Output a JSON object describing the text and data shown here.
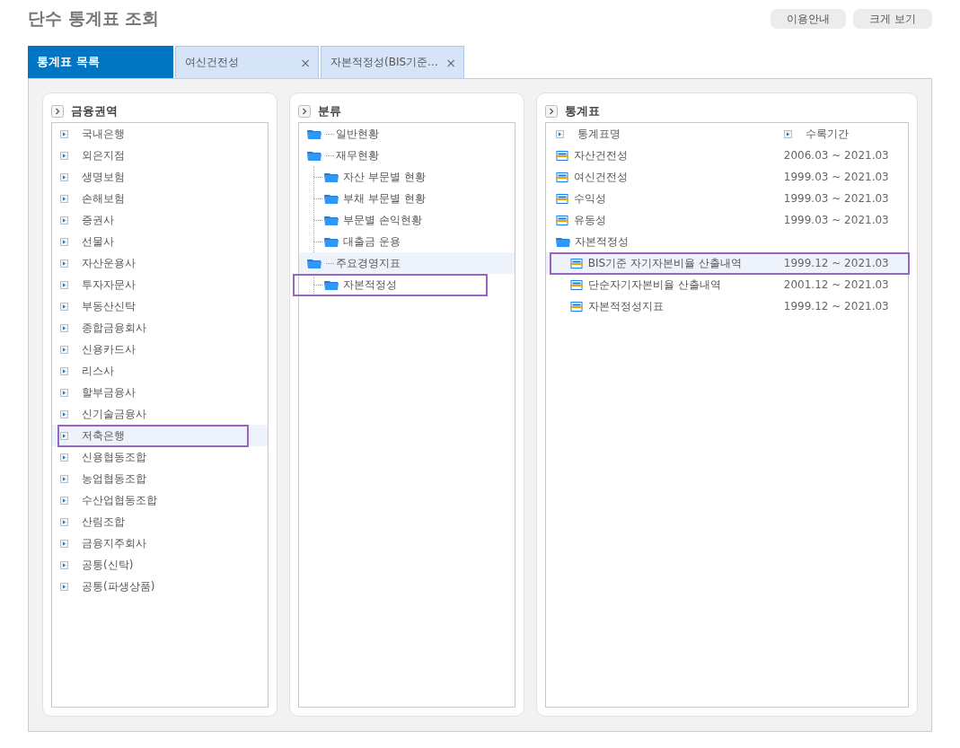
{
  "title": "단수 통계표 조회",
  "header_buttons": [
    "이용안내",
    "크게 보기"
  ],
  "tabs": [
    {
      "label": "통계표 목록",
      "selected": true
    },
    {
      "label": "여신건전성",
      "selected": false,
      "close": "×"
    },
    {
      "label": "자본적정성(BIS기준...",
      "selected": false,
      "close": "×"
    }
  ],
  "sectors": {
    "title": "금융권역",
    "items": [
      {
        "label": "국내은행",
        "selected": false,
        "highlighted": false
      },
      {
        "label": "외은지점",
        "selected": false,
        "highlighted": false
      },
      {
        "label": "생명보험",
        "selected": false,
        "highlighted": false
      },
      {
        "label": "손해보험",
        "selected": false,
        "highlighted": false
      },
      {
        "label": "증권사",
        "selected": false,
        "highlighted": false
      },
      {
        "label": "선물사",
        "selected": false,
        "highlighted": false
      },
      {
        "label": "자산운용사",
        "selected": false,
        "highlighted": false
      },
      {
        "label": "투자자문사",
        "selected": false,
        "highlighted": false
      },
      {
        "label": "부동산신탁",
        "selected": false,
        "highlighted": false
      },
      {
        "label": "종합금융회사",
        "selected": false,
        "highlighted": false
      },
      {
        "label": "신용카드사",
        "selected": false,
        "highlighted": false
      },
      {
        "label": "리스사",
        "selected": false,
        "highlighted": false
      },
      {
        "label": "할부금융사",
        "selected": false,
        "highlighted": false
      },
      {
        "label": "신기술금융사",
        "selected": false,
        "highlighted": false
      },
      {
        "label": "저축은행",
        "selected": true,
        "highlighted": true
      },
      {
        "label": "신용협동조합",
        "selected": false,
        "highlighted": false
      },
      {
        "label": "농업협동조합",
        "selected": false,
        "highlighted": false
      },
      {
        "label": "수산업협동조합",
        "selected": false,
        "highlighted": false
      },
      {
        "label": "산림조합",
        "selected": false,
        "highlighted": false
      },
      {
        "label": "금융지주회사",
        "selected": false,
        "highlighted": false
      },
      {
        "label": "공통(신탁)",
        "selected": false,
        "highlighted": false
      },
      {
        "label": "공통(파생상품)",
        "selected": false,
        "highlighted": false
      }
    ]
  },
  "categories": {
    "title": "분류",
    "items": [
      {
        "label": "일반현황",
        "selected": false,
        "highlighted": false
      },
      {
        "label": "재무현황",
        "selected": false,
        "highlighted": false,
        "children": [
          {
            "label": "자산 부문별 현황",
            "selected": false,
            "highlighted": false
          },
          {
            "label": "부채 부문별 현황",
            "selected": false,
            "highlighted": false
          },
          {
            "label": "부문별 손익현황",
            "selected": false,
            "highlighted": false
          },
          {
            "label": "대출금 운용",
            "selected": false,
            "highlighted": false
          }
        ]
      },
      {
        "label": "주요경영지표",
        "selected": false,
        "highlighted": true,
        "children": [
          {
            "label": "자본적정성",
            "selected": true,
            "highlighted": false
          }
        ]
      }
    ]
  },
  "tables": {
    "title": "통계표",
    "columns": [
      "통계표명",
      "수록기간"
    ],
    "rows": [
      {
        "kind": "table",
        "name": "자산건전성",
        "period": "2006.03 ~ 2021.03",
        "selected": false
      },
      {
        "kind": "table",
        "name": "여신건전성",
        "period": "1999.03 ~ 2021.03",
        "selected": false
      },
      {
        "kind": "table",
        "name": "수익성",
        "period": "1999.03 ~ 2021.03",
        "selected": false
      },
      {
        "kind": "table",
        "name": "유동성",
        "period": "1999.03 ~ 2021.03",
        "selected": false
      },
      {
        "kind": "folder",
        "name": "자본적정성",
        "selected": false,
        "children": [
          {
            "kind": "table",
            "name": "BIS기준 자기자본비율 산출내역",
            "period": "1999.12 ~ 2021.03",
            "selected": true
          },
          {
            "kind": "table",
            "name": "단순자기자본비율 산출내역",
            "period": "2001.12 ~ 2021.03",
            "selected": false
          },
          {
            "kind": "table",
            "name": "자본적정성지표",
            "period": "1999.12 ~ 2021.03",
            "selected": false
          }
        ]
      }
    ]
  }
}
